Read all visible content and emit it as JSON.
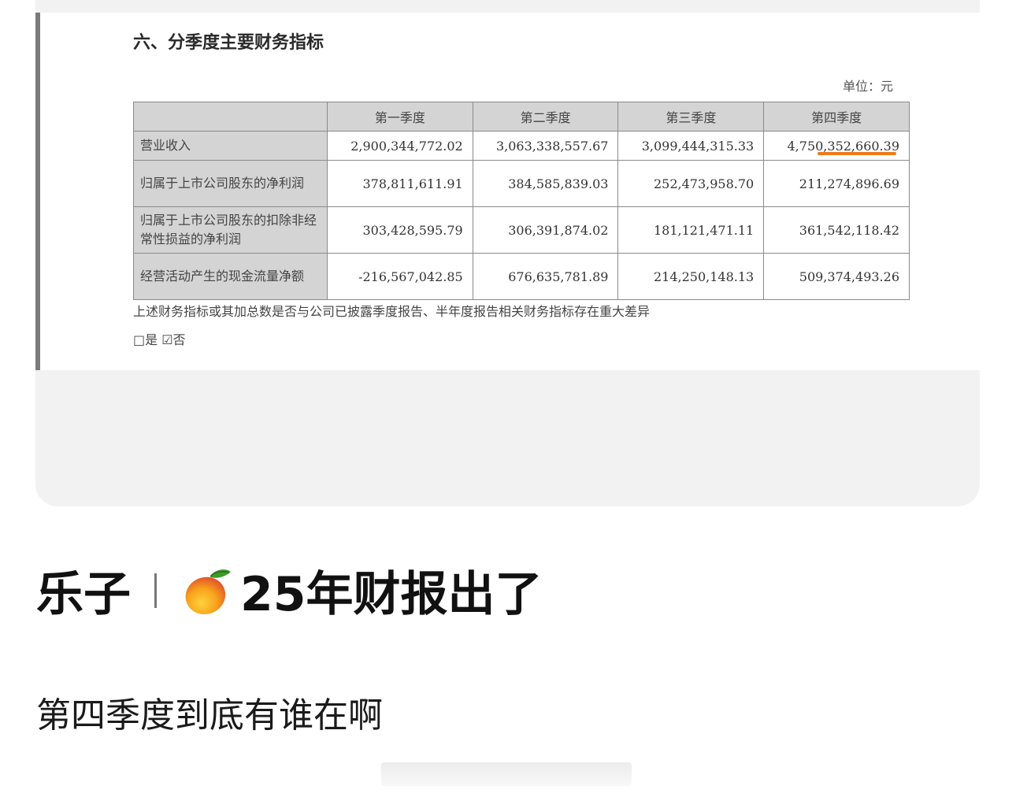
{
  "document": {
    "title": "六、分季度主要财务指标",
    "unit": "单位：元",
    "columns": [
      "",
      "第一季度",
      "第二季度",
      "第三季度",
      "第四季度"
    ],
    "rows": [
      {
        "label": "营业收入",
        "values": [
          "2,900,344,772.02",
          "3,063,338,557.67",
          "3,099,444,315.33",
          "4,750,352,660.39"
        ]
      },
      {
        "label": "归属于上市公司股东的净利润",
        "values": [
          "378,811,611.91",
          "384,585,839.03",
          "252,473,958.70",
          "211,274,896.69"
        ]
      },
      {
        "label": "归属于上市公司股东的扣除非经常性损益的净利润",
        "values": [
          "303,428,595.79",
          "306,391,874.02",
          "181,121,471.11",
          "361,542,118.42"
        ]
      },
      {
        "label": "经营活动产生的现金流量净额",
        "values": [
          "-216,567,042.85",
          "676,635,781.89",
          "214,250,148.13",
          "509,374,493.26"
        ]
      }
    ],
    "note": "上述财务指标或其加总数是否与公司已披露季度报告、半年度报告相关财务指标存在重大差异",
    "checkbox_text": "□是 ☑否",
    "highlight_color": "#f07a1a"
  },
  "post": {
    "author": "乐子",
    "emoji_icon": "mango-icon",
    "title": "25年财报出了",
    "body": "第四季度到底有谁在啊"
  }
}
